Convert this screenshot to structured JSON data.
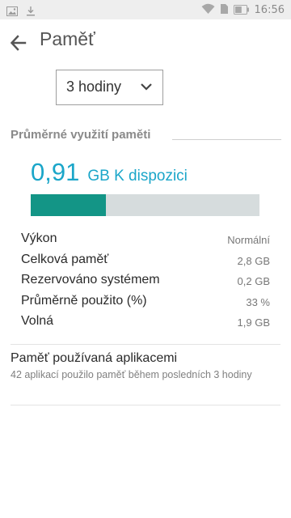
{
  "status_bar": {
    "time": "16:56",
    "battery_level": 0.6
  },
  "header": {
    "title": "Paměť"
  },
  "period_select": {
    "selected": "3 hodiny"
  },
  "section": {
    "title": "Průměrné využití paměti"
  },
  "available": {
    "value": "0,91",
    "unit_label": "GB K dispozici",
    "used_fraction": 0.33
  },
  "stats": [
    {
      "label": "Výkon",
      "value": "Normální"
    },
    {
      "label": "Celková paměť",
      "value": "2,8 GB"
    },
    {
      "label": "Rezervováno systémem",
      "value": "0,2 GB"
    },
    {
      "label": "Průměrně použito (%)",
      "value": "33 %"
    },
    {
      "label": "Volná",
      "value": "1,9 GB"
    }
  ],
  "apps_memory": {
    "title": "Paměť používaná aplikacemi",
    "subtitle": "42 aplikací použilo paměť během posledních 3 hodiny"
  },
  "colors": {
    "accent": "#1ba6c9",
    "bar_fill": "#139586",
    "bar_track": "#d6dcdd"
  }
}
